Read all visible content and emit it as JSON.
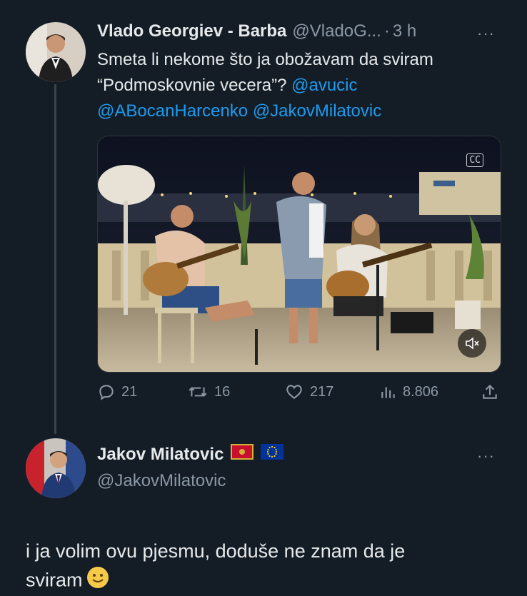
{
  "tweet1": {
    "author_name": "Vlado Georgiev - Barba",
    "author_handle": "@VladoG...",
    "dot": "·",
    "time": "3 h",
    "more": "···",
    "text_line1": "Smeta li nekome što ja obožavam da sviram",
    "text_line2_plain": "“Podmoskovnie vecera”? ",
    "mentions": [
      "@avucic",
      "@ABocanHarcenko",
      "@JakovMilatovic"
    ],
    "media_badge": "CC",
    "actions": {
      "replies": "21",
      "retweets": "16",
      "likes": "217",
      "views": "8.806"
    }
  },
  "tweet2": {
    "author_name": "Jakov Milatovic",
    "author_handle": "@JakovMilatovic",
    "more": "···",
    "text_line1": "i ja volim ovu pjesmu, doduše ne znam da je",
    "text_line2": "sviram"
  },
  "colors": {
    "background": "#141d26",
    "text": "#e7e9ea",
    "muted": "#8b98a5",
    "accent": "#1d9bf0",
    "thread_line": "#38444d"
  },
  "icons": [
    "reply-icon",
    "retweet-icon",
    "like-icon",
    "views-icon",
    "share-icon",
    "mute-icon",
    "more-icon",
    "montenegro-flag-icon",
    "eu-flag-icon",
    "smile-emoji-icon"
  ]
}
